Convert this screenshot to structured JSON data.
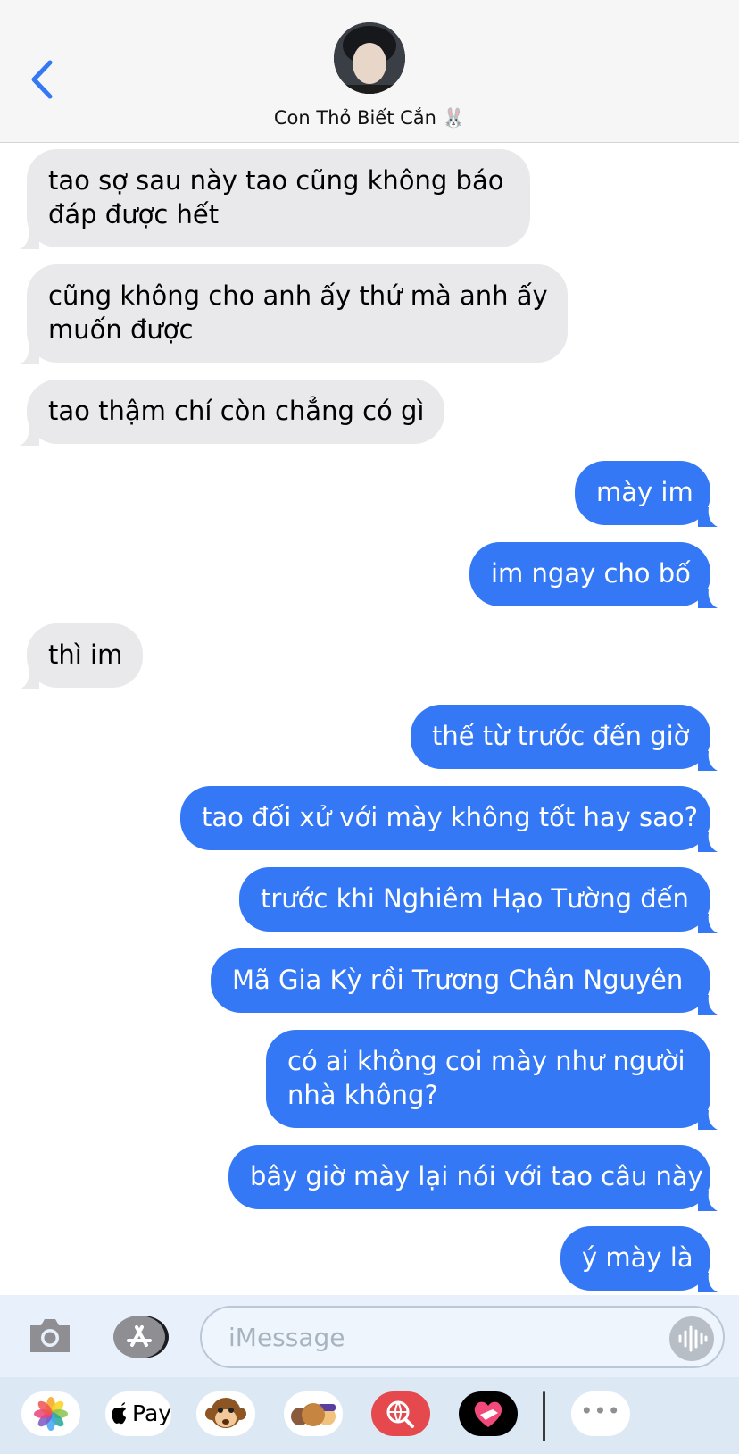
{
  "header": {
    "contact_name": "Con Thỏ Biết Cắn",
    "contact_emoji": "🐰"
  },
  "messages": [
    {
      "dir": "in",
      "text": "tao sợ sau này tao cũng không báo\nđáp được hết"
    },
    {
      "dir": "in",
      "text": "cũng không cho anh ấy thứ mà anh ấy\nmuốn được"
    },
    {
      "dir": "in",
      "text": "tao thậm chí còn chẳng có gì"
    },
    {
      "dir": "out",
      "text": "mày im"
    },
    {
      "dir": "out",
      "text": "im ngay cho bố"
    },
    {
      "dir": "in",
      "text": "thì im"
    },
    {
      "dir": "out",
      "text": "thế từ trước đến giờ"
    },
    {
      "dir": "out",
      "text": "tao đối xử với mày không tốt hay sao?"
    },
    {
      "dir": "out",
      "text": "trước khi Nghiêm Hạo Tường đến"
    },
    {
      "dir": "out",
      "text": "Mã Gia Kỳ rồi Trương Chân Nguyên"
    },
    {
      "dir": "out",
      "text": "có ai không coi mày như người\nnhà không?"
    },
    {
      "dir": "out",
      "text": "bây giờ mày lại nói với tao câu này"
    },
    {
      "dir": "out",
      "text": "ý mày là"
    }
  ],
  "input": {
    "placeholder": "iMessage"
  },
  "app_drawer": {
    "apple_pay_label": "Pay",
    "more_label": "•••",
    "apps": [
      "photos-app",
      "apple-pay-app",
      "animoji-app",
      "memoji-app",
      "search-images-app",
      "digital-touch-app",
      "more-apps"
    ]
  },
  "colors": {
    "outgoing": "#3478f6",
    "incoming": "#e9e9eb",
    "accent": "#3478f6"
  }
}
